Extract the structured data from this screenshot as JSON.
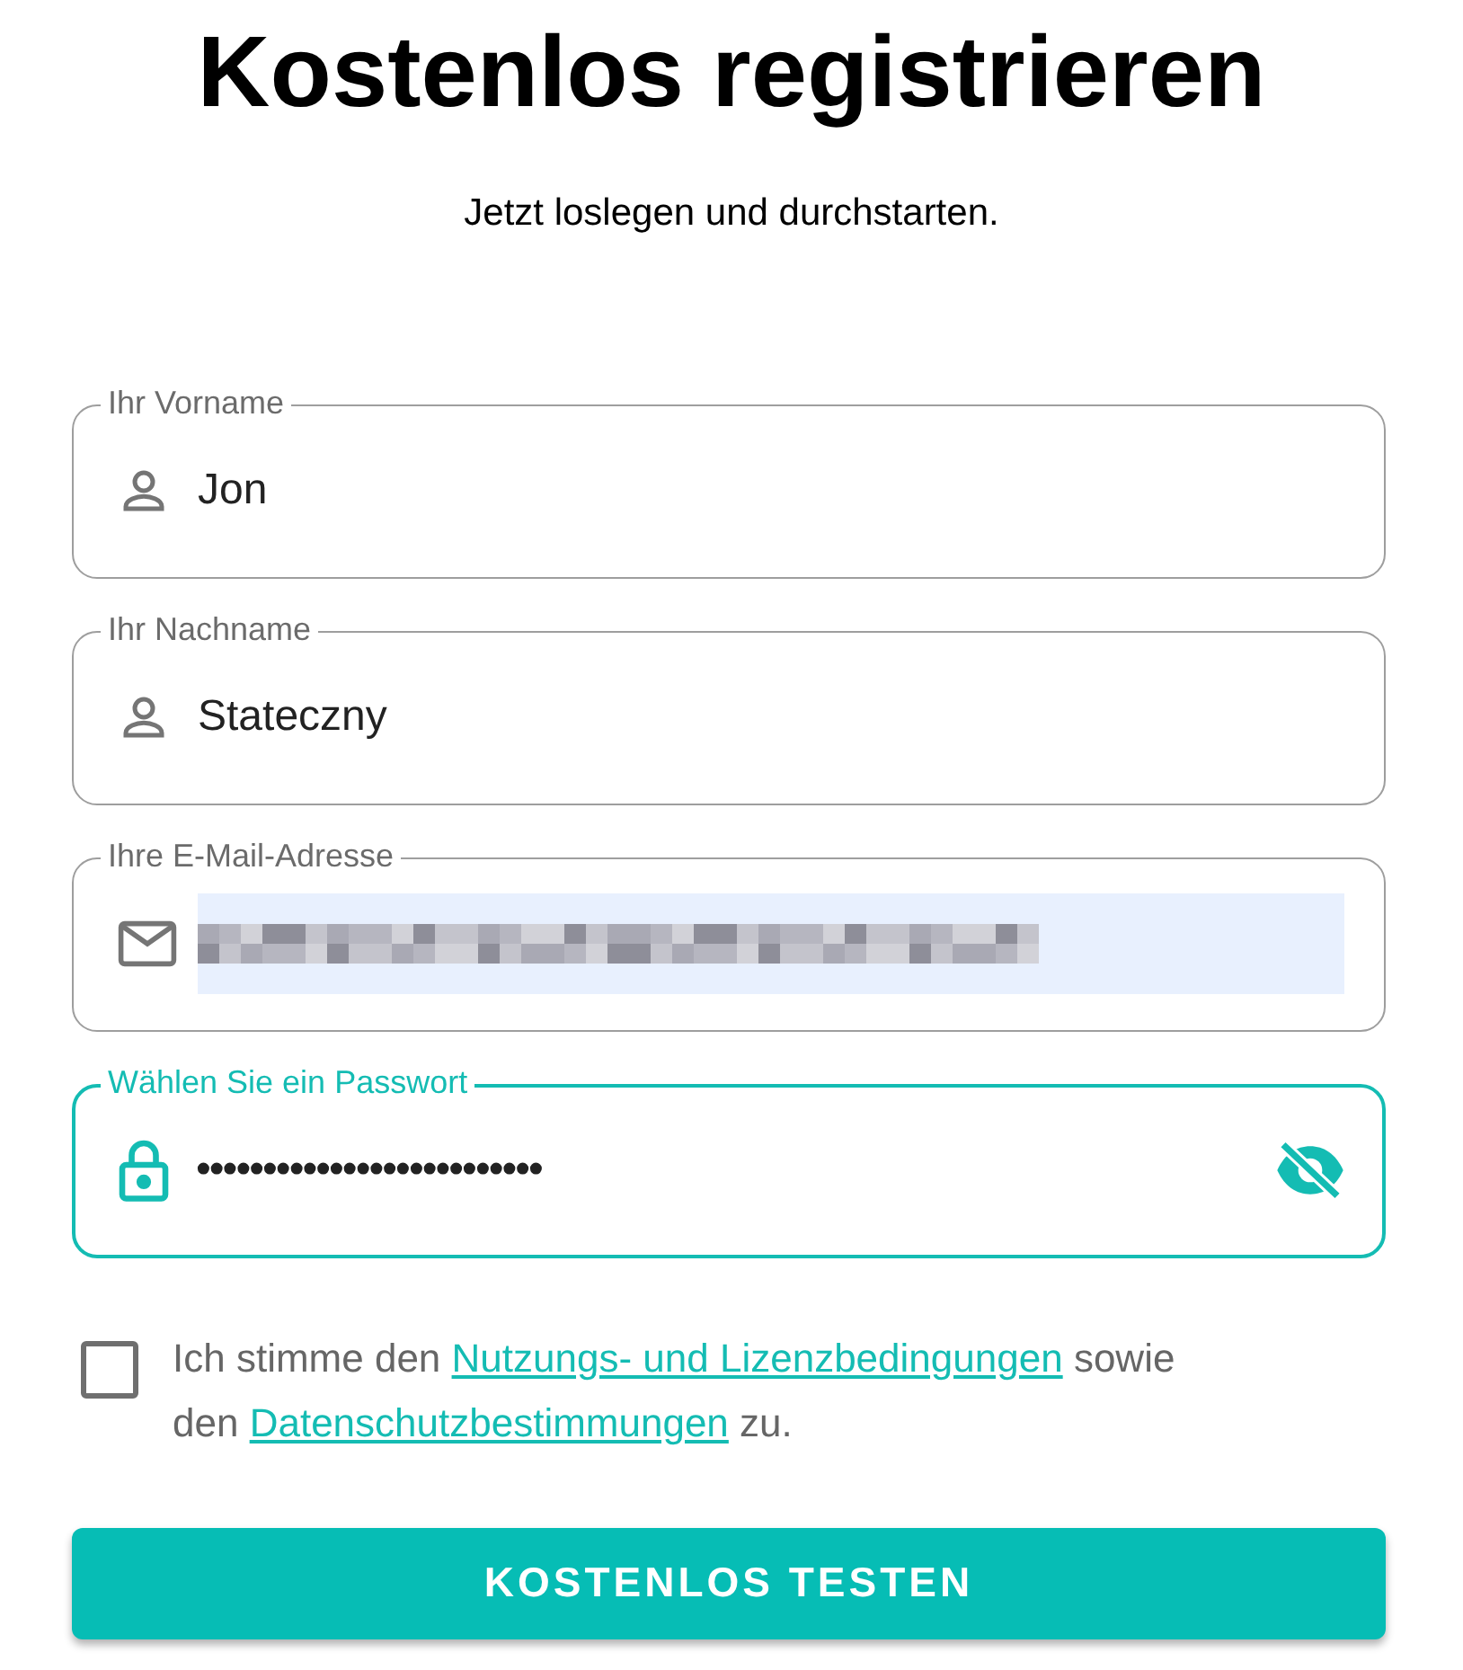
{
  "title": "Kostenlos registrieren",
  "subtitle": "Jetzt loslegen und durchstarten.",
  "fields": [
    {
      "kind": "person",
      "label": "Ihr Vorname",
      "value": "Jon",
      "focused": false
    },
    {
      "kind": "person",
      "label": "Ihr Nachname",
      "value": "Stateczny",
      "focused": false
    },
    {
      "kind": "email",
      "label": "Ihre E-Mail-Adresse",
      "autofilled": true,
      "redacted": true,
      "focused": false
    },
    {
      "kind": "password",
      "label": "Wählen Sie ein Passwort",
      "value": "••••••••••••••••••••••••••",
      "focused": true,
      "visibility_toggle": true
    }
  ],
  "consent": {
    "checked": false,
    "parts": [
      {
        "kind": "text",
        "text": "Ich stimme den "
      },
      {
        "kind": "link",
        "text": "Nutzungs- und Lizenzbedingungen"
      },
      {
        "kind": "text",
        "text": " sowie den "
      },
      {
        "kind": "link",
        "text": "Datenschutzbestimmungen"
      },
      {
        "kind": "text",
        "text": " zu."
      }
    ]
  },
  "submit": "KOSTENLOS TESTEN"
}
